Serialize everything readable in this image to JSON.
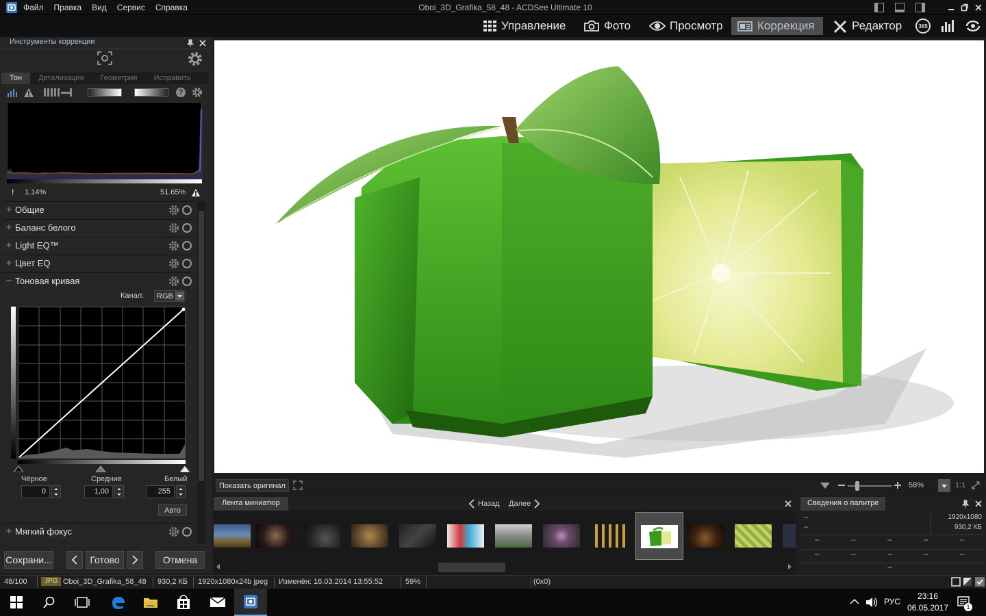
{
  "app": {
    "title": "Oboi_3D_Grafika_58_48 - ACDSee Ultimate 10",
    "menu": [
      "Файл",
      "Правка",
      "Вид",
      "Сервис",
      "Справка"
    ]
  },
  "modes": {
    "manage": "Управление",
    "photo": "Фото",
    "view": "Просмотр",
    "develop": "Коррекция",
    "edit": "Редактор",
    "badge365": "365"
  },
  "panel": {
    "title": "Инструменты коррекции",
    "tabs": [
      "Тон",
      "Детализация",
      "Геометрия",
      "Исправить"
    ],
    "histogram": {
      "low_clip": "1.14%",
      "high_clip": "51.65%"
    },
    "sections": {
      "general": "Общие",
      "white_balance": "Баланс белого",
      "light_eq": "Light EQ™",
      "color_eq": "Цвет EQ",
      "tone_curve": "Тоновая кривая",
      "soft_focus": "Мягкий фокус"
    },
    "tone_curve": {
      "channel_label": "Канал:",
      "channel_value": "RGB",
      "black_label": "Чёрное",
      "mid_label": "Средние",
      "white_label": "Белый",
      "black_value": "0",
      "mid_value": "1,00",
      "white_value": "255",
      "auto_label": "Авто"
    },
    "buttons": {
      "save": "Сохрани...",
      "done": "Готово",
      "cancel": "Отмена"
    }
  },
  "viewbar": {
    "show_original": "Показать оригинал",
    "zoom": "58%",
    "one_to_one": "1:1"
  },
  "filmstrip": {
    "title": "Лента миниатюр",
    "back": "Назад",
    "next": "Далее"
  },
  "palette": {
    "title": "Сведения о палитре",
    "dims": "1920x1080",
    "size": "930,2 КБ",
    "placeholder": "--"
  },
  "status": {
    "index": "48/100",
    "format": "JPG",
    "filename": "Oboi_3D_Grafika_58_48",
    "filesize": "930,2 КБ",
    "dims": "1920x1080x24b jpeg",
    "modified": "Изменён: 16.03.2014 13:55:52",
    "zoom": "59%",
    "coords": "(0x0)"
  },
  "taskbar": {
    "lang": "РУС",
    "time": "23:16",
    "date": "06.05.2017",
    "notifications": "1"
  },
  "colors": {
    "accent": "#a9c2d8",
    "active_mode_bg": "#4d4d4d",
    "lime_dark": "#2f8a16",
    "lime_light": "#63c232",
    "lemon_flesh": "#e6ec9a"
  },
  "icons": [
    "app-logo-icon",
    "grid-icon",
    "camera-icon",
    "eye-icon",
    "develop-icon",
    "edit-tools-icon",
    "365-icon",
    "chart-icon",
    "refresh-icon",
    "pin-icon",
    "close-icon",
    "gear-icon",
    "windows-icon",
    "search-icon",
    "task-view-icon",
    "edge-icon",
    "folder-icon",
    "store-icon",
    "mail-icon",
    "acdsee-icon"
  ]
}
